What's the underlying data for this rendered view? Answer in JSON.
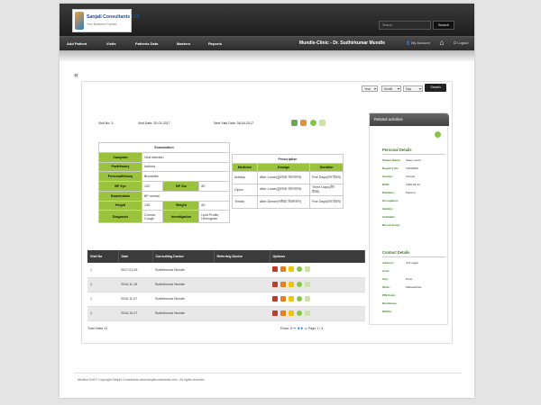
{
  "logo": {
    "name": "Sanjali Consultants LLP",
    "tagline": "Your Business Partner"
  },
  "header": {
    "search_placeholder": "Search",
    "search_button": "Search"
  },
  "nav": {
    "items": [
      "Add Patient",
      "Visits",
      "Patients Data",
      "Masters",
      "Reports"
    ],
    "clinic": "Mundle-Clinic - Dr. Sudhirkumar Mundle",
    "my_account": "My Account",
    "logout": "Logout"
  },
  "filters": {
    "year": "Year",
    "month": "Month",
    "day": "Day",
    "search_button": "Search"
  },
  "visit": {
    "visit_no": "Visit No: 3",
    "visit_date": "Visit Date: 20-03-2017",
    "next_visit": "Next Visit Date: 08-04-2017"
  },
  "examination": {
    "title": "Examination",
    "rows": [
      {
        "label": "Complain",
        "value": "Viral infection"
      },
      {
        "label": "PastHistory",
        "value": "Asthma"
      },
      {
        "label": "PersonalHistory",
        "value": "Bronchitis"
      }
    ],
    "bp_sys_label": "BP Sys",
    "bp_sys": "120",
    "bp_dia_label": "BP Dia",
    "bp_dia": "80",
    "exam_label": "Examination",
    "exam_value": "BP normal",
    "height_label": "Height",
    "height": "145",
    "weight_label": "Weight",
    "weight": "60",
    "diagnosis_label": "Diagnosis",
    "diagnosis": "Chronic Cough",
    "investigation_label": "Investigation",
    "investigation": "Lipid Profile, Hemogram"
  },
  "prescription": {
    "title": "Prescription",
    "headers": [
      "Medicine",
      "Dosage",
      "Duration"
    ],
    "rows": [
      {
        "medicine": "Antidep",
        "dosage": "After Lunch(दुपारच्या जेवणानंतर)",
        "duration": "Five Days(पाच दिवस)"
      },
      {
        "medicine": "Ciplox",
        "dosage": "After Lunch(दुपारच्या जेवणानंतर)",
        "duration": "Three Days(तीन दिवस)"
      },
      {
        "medicine": "Tendia",
        "dosage": "After Dinner(रात्रीच्या जेवणानंतर)",
        "duration": "Five Days(पाच दिवस)"
      }
    ]
  },
  "visits_table": {
    "headers": [
      "Visit No",
      "Date",
      "Consulting Doctor",
      "Referring Doctor",
      "Options"
    ],
    "rows": [
      {
        "no": "1",
        "date": "2017-01-05",
        "doctor": "Sudhirkumar Mundle",
        "ref": ""
      },
      {
        "no": "1",
        "date": "2016-11-18",
        "doctor": "Sudhirkumar Mundle",
        "ref": ""
      },
      {
        "no": "1",
        "date": "2016-11-07",
        "doctor": "Sudhirkumar Mundle",
        "ref": ""
      },
      {
        "no": "1",
        "date": "2016-10-07",
        "doctor": "Sudhirkumar Mundle",
        "ref": ""
      }
    ],
    "total": "Total Visits 13",
    "rows_label": "Rows:",
    "rows_value": "5",
    "page": "Page 1 / 3"
  },
  "side": {
    "header": "Related activities",
    "personal_title": "Personal Details",
    "personal": [
      {
        "label": "Patient Name:",
        "value": "Saley Laxmi"
      },
      {
        "label": "Registry No:",
        "value": "13040690"
      },
      {
        "label": "Gender:",
        "value": "Female"
      },
      {
        "label": "DOB:",
        "value": "1990-04-22"
      },
      {
        "label": "M.Status:",
        "value": "Married"
      },
      {
        "label": "Occupation:",
        "value": ""
      },
      {
        "label": "Identity:",
        "value": ""
      },
      {
        "label": "Id Details:",
        "value": ""
      },
      {
        "label": "Blood Group:",
        "value": ""
      }
    ],
    "contact_title": "Contact Details",
    "contact": [
      {
        "label": "Address:",
        "value": "Atul nagar"
      },
      {
        "label": "Area:",
        "value": ""
      },
      {
        "label": "City:",
        "value": "Pune"
      },
      {
        "label": "State:",
        "value": "Maharashtra"
      },
      {
        "label": "PIN Code:",
        "value": ""
      },
      {
        "label": "Residence:",
        "value": ""
      },
      {
        "label": "Mobile:",
        "value": ""
      }
    ]
  },
  "footer": "Medical Soft © Copyright Sanjali Consultants www.sanjaliconsultants.com . All rights reserved.",
  "colors": {
    "accent_green": "#9bc23c",
    "header_dark": "#2c2c2c",
    "label_green": "#3a7d1e"
  }
}
